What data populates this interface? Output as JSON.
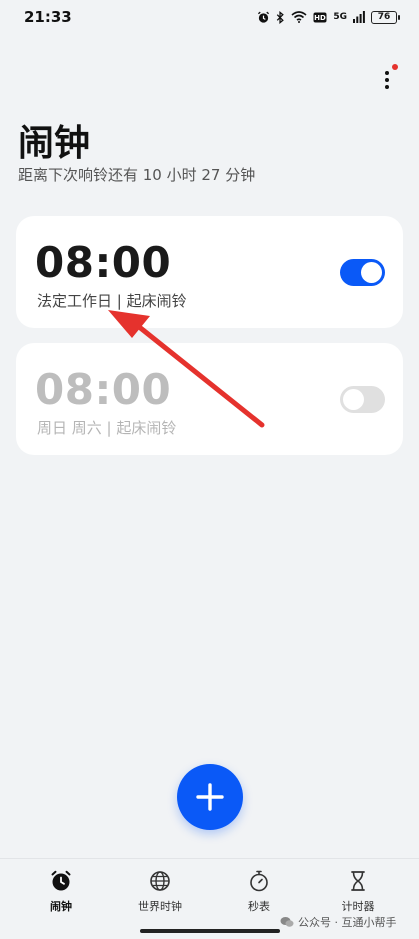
{
  "status_bar": {
    "time": "21:33",
    "network": "5G",
    "battery": "76",
    "icons": [
      "alarm-icon",
      "bluetooth-icon",
      "wifi-icon",
      "hd-icon",
      "signal-icon",
      "battery-icon"
    ]
  },
  "header": {
    "title": "闹钟",
    "next_alarm": "距离下次响铃还有 10 小时 27 分钟"
  },
  "alarms": [
    {
      "time": "08:00",
      "desc": "法定工作日 | 起床闹铃",
      "enabled": true
    },
    {
      "time": "08:00",
      "desc": "周日 周六 | 起床闹铃",
      "enabled": false
    }
  ],
  "fab": {
    "icon": "plus-icon"
  },
  "nav": {
    "items": [
      {
        "label": "闹钟",
        "icon": "alarm-clock-icon",
        "active": true
      },
      {
        "label": "世界时钟",
        "icon": "globe-icon",
        "active": false
      },
      {
        "label": "秒表",
        "icon": "stopwatch-icon",
        "active": false
      },
      {
        "label": "计时器",
        "icon": "hourglass-icon",
        "active": false
      }
    ]
  },
  "watermark": "公众号 · 互通小帮手",
  "colors": {
    "accent": "#0a59f7",
    "annotation": "#e5322d",
    "background": "#f1f3f5",
    "card": "#ffffff"
  }
}
